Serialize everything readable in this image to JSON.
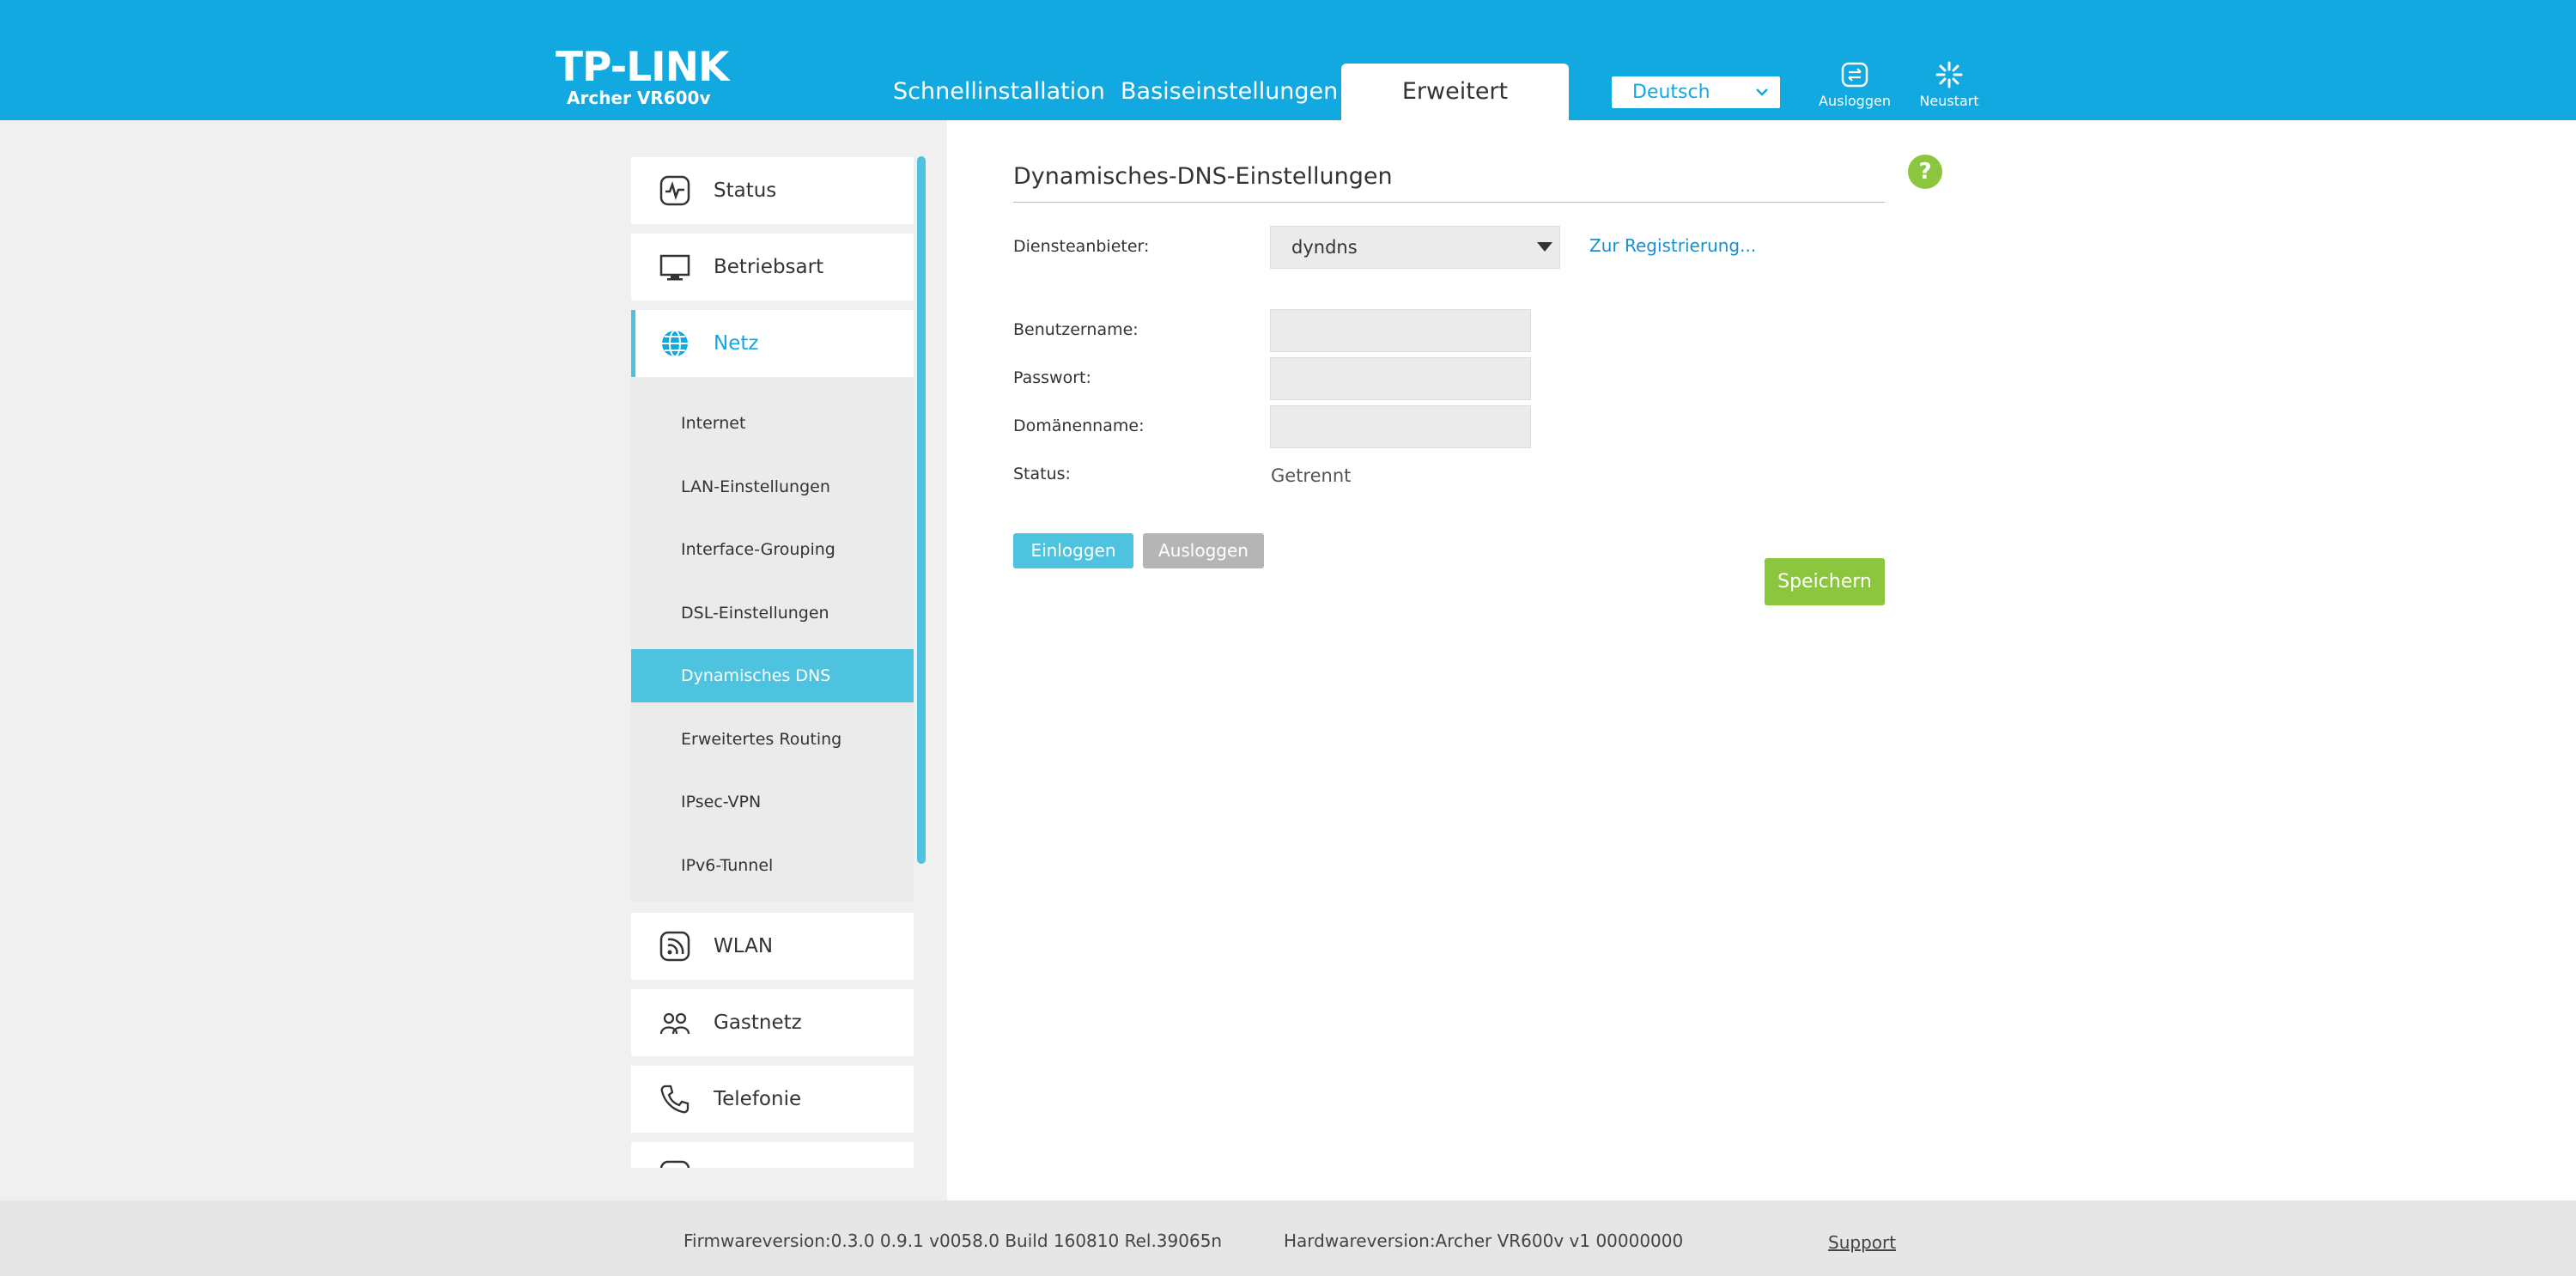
{
  "header": {
    "brand": "TP-LINK",
    "model": "Archer VR600v",
    "tabs": [
      {
        "label": "Schnellinstallation"
      },
      {
        "label": "Basiseinstellungen"
      },
      {
        "label": "Erweitert",
        "active": true
      }
    ],
    "language": "Deutsch",
    "logout_label": "Ausloggen",
    "reboot_label": "Neustart",
    "logout_icon": "logout-icon",
    "reboot_icon": "reboot-icon"
  },
  "sidebar": {
    "items": [
      {
        "label": "Status",
        "icon": "status-icon"
      },
      {
        "label": "Betriebsart",
        "icon": "monitor-icon"
      },
      {
        "label": "Netz",
        "icon": "globe-icon",
        "active": true
      },
      {
        "label": "WLAN",
        "icon": "wifi-icon"
      },
      {
        "label": "Gastnetz",
        "icon": "guests-icon"
      },
      {
        "label": "Telefonie",
        "icon": "phone-icon"
      }
    ],
    "subitems": [
      {
        "label": "Internet"
      },
      {
        "label": "LAN-Einstellungen"
      },
      {
        "label": "Interface-Grouping"
      },
      {
        "label": "DSL-Einstellungen"
      },
      {
        "label": "Dynamisches DNS",
        "active": true
      },
      {
        "label": "Erweitertes Routing"
      },
      {
        "label": "IPsec-VPN"
      },
      {
        "label": "IPv6-Tunnel"
      }
    ]
  },
  "form": {
    "title": "Dynamisches-DNS-Einstellungen",
    "provider_label": "Diensteanbieter:",
    "provider_value": "dyndns",
    "register_link": "Zur Registrierung...",
    "username_label": "Benutzername:",
    "username_value": "",
    "password_label": "Passwort:",
    "password_value": "",
    "domain_label": "Domänenname:",
    "domain_value": "",
    "status_label": "Status:",
    "status_value": "Getrennt",
    "login_button": "Einloggen",
    "logout_button": "Ausloggen",
    "save_button": "Speichern",
    "help_symbol": "?"
  },
  "footer": {
    "firmware": "Firmwareversion:0.3.0 0.9.1 v0058.0 Build 160810 Rel.39065n",
    "hardware": "Hardwareversion:Archer VR600v v1 00000000",
    "support": "Support"
  },
  "colors": {
    "header_blue": "#12a8e0",
    "accent_cyan": "#4ec3e0",
    "save_green": "#8cc63f"
  }
}
